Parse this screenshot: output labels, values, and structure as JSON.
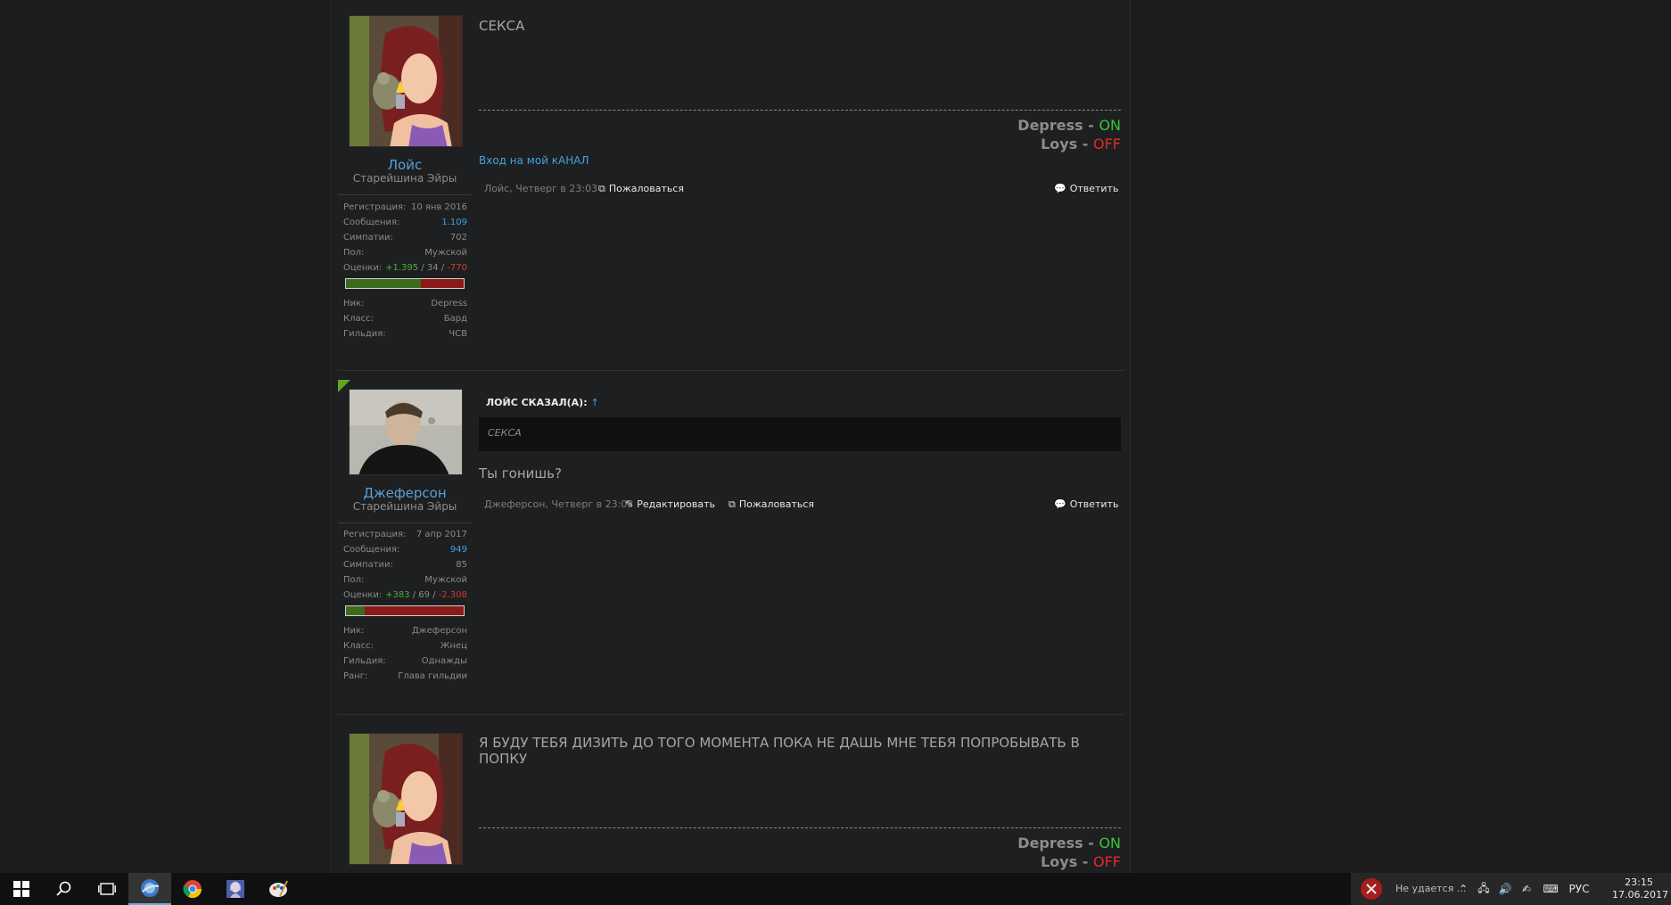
{
  "posts": [
    {
      "author": "Лойс",
      "title": "Старейшина Эйры",
      "stats": {
        "reg_label": "Регистрация:",
        "reg": "10 янв 2016",
        "msgs_label": "Сообщения:",
        "msgs": "1.109",
        "likes_label": "Симпатии:",
        "likes": "702",
        "gender_label": "Пол:",
        "gender": "Мужской",
        "rating_label": "Оценки:",
        "rating_pos": "+1.395",
        "rating_sep1": " / ",
        "rating_neutral": "34",
        "rating_sep2": " / ",
        "rating_neg": "-770",
        "rating_positive_share": 0.64,
        "nick_label": "Ник:",
        "nick": "Depress",
        "class_label": "Класс:",
        "class": "Бард",
        "guild_label": "Гильдия:",
        "guild": "ЧСВ"
      },
      "text": "СЕКСА",
      "signature": {
        "l1_name": "Depress",
        "l1_sep": " - ",
        "l1_state": "ON",
        "l2_name": "Loys",
        "l2_sep": " - ",
        "l2_state": "OFF"
      },
      "link": "Вход на мой кАНАЛ",
      "meta": "Лойс, Четверг в 23:03",
      "report": "Пожаловаться",
      "reply": "Ответить"
    },
    {
      "author": "Джеферсон",
      "title": "Старейшина Эйры",
      "stats": {
        "reg_label": "Регистрация:",
        "reg": "7 апр 2017",
        "msgs_label": "Сообщения:",
        "msgs": "949",
        "likes_label": "Симпатии:",
        "likes": "85",
        "gender_label": "Пол:",
        "gender": "Мужской",
        "rating_label": "Оценки:",
        "rating_pos": "+383",
        "rating_sep1": " / ",
        "rating_neutral": "69",
        "rating_sep2": " / ",
        "rating_neg": "-2.308",
        "rating_positive_share": 0.16,
        "nick_label": "Ник:",
        "nick": "Джеферсон",
        "class_label": "Класс:",
        "class": "Жнец",
        "guild_label": "Гильдия:",
        "guild": "Однажды",
        "rank_label": "Ранг:",
        "rank": "Глава гильдии"
      },
      "quote_author": "ЛОЙС СКАЗАЛ(А):",
      "quote_arrow": "↑",
      "quote_text": "СЕКСА",
      "text": "Ты гонишь?",
      "meta": "Джеферсон, Четверг в 23:03",
      "edit": "Редактировать",
      "report": "Пожаловаться",
      "reply": "Ответить"
    },
    {
      "author": "Лойс",
      "text": "Я БУДУ ТЕБЯ ДИЗИТЬ ДО ТОГО МОМЕНТА ПОКА НЕ ДАШЬ МНЕ ТЕБЯ ПОПРОБЫВАТЬ В ПОПКУ",
      "signature": {
        "l1_name": "Depress",
        "l1_sep": " - ",
        "l1_state": "ON",
        "l2_name": "Loys",
        "l2_sep": " - ",
        "l2_state": "OFF"
      }
    }
  ],
  "taskbar": {
    "lang": "РУС",
    "time": "23:15",
    "date": "17.06.2017",
    "notification": "Не удается ..."
  }
}
